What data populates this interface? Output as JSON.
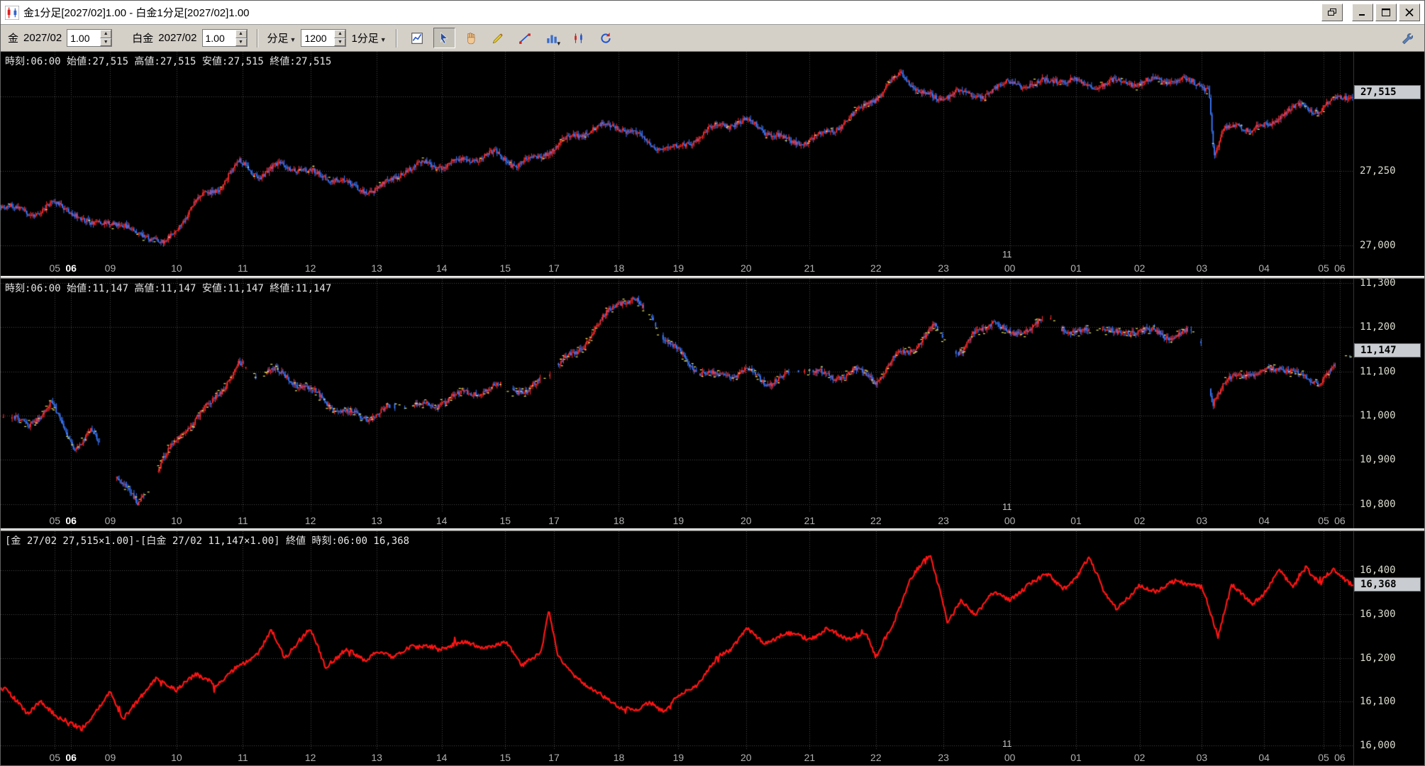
{
  "window": {
    "title": "金1分足[2027/02]1.00 - 白金1分足[2027/02]1.00"
  },
  "toolbar": {
    "gold_label": "金",
    "gold_contract": "2027/02",
    "gold_multiplier": "1.00",
    "platinum_label": "白金",
    "platinum_contract": "2027/02",
    "platinum_multiplier": "1.00",
    "interval_label": "分足",
    "bar_count": "1200",
    "timeframe": "1分足",
    "tools": [
      "chart-grid-tool",
      "pointer-tool",
      "hand-tool",
      "pencil-tool",
      "trendline-tool",
      "bar-chart-tool",
      "candle-chart-tool",
      "refresh-tool",
      "wrench-settings"
    ]
  },
  "x_axis": {
    "labels": [
      "05",
      "06",
      "09",
      "10",
      "11",
      "12",
      "13",
      "14",
      "15",
      "17",
      "18",
      "19",
      "20",
      "21",
      "22",
      "23",
      "00",
      "01",
      "02",
      "03",
      "04",
      "05",
      "06"
    ],
    "fractions": [
      0.04,
      0.052,
      0.081,
      0.13,
      0.179,
      0.229,
      0.278,
      0.326,
      0.373,
      0.409,
      0.457,
      0.501,
      0.551,
      0.598,
      0.647,
      0.697,
      0.746,
      0.795,
      0.842,
      0.888,
      0.934,
      0.978,
      0.99
    ],
    "bold_index": 1,
    "date_marker": {
      "label": "11",
      "fraction": 0.744
    }
  },
  "chart_data": [
    {
      "type": "candlestick",
      "symbol": "金",
      "contract": "2027/02",
      "timeframe": "1分足",
      "info_line": "時刻:06:00 始値:27,515 高値:27,515 安値:27,515 終値:27,515",
      "time": "06:00",
      "open": 27515,
      "high": 27515,
      "low": 27515,
      "close": 27515,
      "current_price": 27515,
      "current_price_label": "27,515",
      "ylim": [
        26950,
        27650
      ],
      "grid_values": [
        27500,
        27250,
        27000
      ],
      "y_ticks": [
        {
          "label": "27,250",
          "value": 27250
        },
        {
          "label": "27,000",
          "value": 27000
        }
      ],
      "bars": 1100,
      "volatility": 13,
      "seed": 11,
      "sparse": false,
      "yellow_prob": 0.06,
      "up_color": "#ff2d2d",
      "down_color": "#3b78ff",
      "accent_color": "#e8e85a",
      "waypoints": [
        [
          0.005,
          27130
        ],
        [
          0.02,
          27095
        ],
        [
          0.037,
          27140
        ],
        [
          0.054,
          27120
        ],
        [
          0.067,
          27070
        ],
        [
          0.081,
          27090
        ],
        [
          0.094,
          27050
        ],
        [
          0.108,
          27030
        ],
        [
          0.121,
          26995
        ],
        [
          0.131,
          27060
        ],
        [
          0.144,
          27150
        ],
        [
          0.161,
          27200
        ],
        [
          0.176,
          27285
        ],
        [
          0.192,
          27235
        ],
        [
          0.208,
          27270
        ],
        [
          0.225,
          27240
        ],
        [
          0.242,
          27230
        ],
        [
          0.262,
          27200
        ],
        [
          0.278,
          27190
        ],
        [
          0.296,
          27250
        ],
        [
          0.313,
          27270
        ],
        [
          0.329,
          27260
        ],
        [
          0.349,
          27290
        ],
        [
          0.366,
          27310
        ],
        [
          0.38,
          27280
        ],
        [
          0.397,
          27300
        ],
        [
          0.409,
          27330
        ],
        [
          0.423,
          27360
        ],
        [
          0.44,
          27390
        ],
        [
          0.457,
          27400
        ],
        [
          0.47,
          27370
        ],
        [
          0.484,
          27340
        ],
        [
          0.501,
          27330
        ],
        [
          0.517,
          27370
        ],
        [
          0.534,
          27400
        ],
        [
          0.551,
          27410
        ],
        [
          0.568,
          27380
        ],
        [
          0.585,
          27350
        ],
        [
          0.598,
          27360
        ],
        [
          0.615,
          27390
        ],
        [
          0.632,
          27440
        ],
        [
          0.649,
          27500
        ],
        [
          0.665,
          27570
        ],
        [
          0.679,
          27520
        ],
        [
          0.692,
          27490
        ],
        [
          0.706,
          27530
        ],
        [
          0.719,
          27500
        ],
        [
          0.733,
          27520
        ],
        [
          0.746,
          27540
        ],
        [
          0.763,
          27530
        ],
        [
          0.78,
          27560
        ],
        [
          0.796,
          27550
        ],
        [
          0.813,
          27545
        ],
        [
          0.83,
          27555
        ],
        [
          0.842,
          27540
        ],
        [
          0.86,
          27550
        ],
        [
          0.877,
          27545
        ],
        [
          0.888,
          27540
        ],
        [
          0.893,
          27530
        ],
        [
          0.897,
          27295
        ],
        [
          0.904,
          27390
        ],
        [
          0.914,
          27420
        ],
        [
          0.924,
          27390
        ],
        [
          0.934,
          27400
        ],
        [
          0.948,
          27440
        ],
        [
          0.961,
          27460
        ],
        [
          0.975,
          27450
        ],
        [
          0.985,
          27480
        ],
        [
          1.0,
          27515
        ]
      ]
    },
    {
      "type": "candlestick",
      "symbol": "白金",
      "contract": "2027/02",
      "timeframe": "1分足",
      "info_line": "時刻:06:00 始値:11,147 高値:11,147 安値:11,147 終値:11,147",
      "time": "06:00",
      "open": 11147,
      "high": 11147,
      "low": 11147,
      "close": 11147,
      "current_price": 11147,
      "current_price_label": "11,147",
      "ylim": [
        10780,
        11310
      ],
      "grid_values": [
        11300,
        11200,
        11100,
        11000,
        10900,
        10800
      ],
      "y_ticks": [
        {
          "label": "11,300",
          "value": 11300
        },
        {
          "label": "11,200",
          "value": 11200
        },
        {
          "label": "11,100",
          "value": 11100
        },
        {
          "label": "11,000",
          "value": 11000
        },
        {
          "label": "10,900",
          "value": 10900
        },
        {
          "label": "10,800",
          "value": 10800
        }
      ],
      "bars": 1100,
      "volatility": 9,
      "seed": 23,
      "sparse": true,
      "yellow_prob": 0.25,
      "up_color": "#ff2d2d",
      "down_color": "#3b78ff",
      "accent_color": "#e8e85a",
      "waypoints": [
        [
          0.005,
          11000
        ],
        [
          0.02,
          10970
        ],
        [
          0.037,
          11030
        ],
        [
          0.054,
          10930
        ],
        [
          0.067,
          10970
        ],
        [
          0.081,
          10890
        ],
        [
          0.094,
          10827
        ],
        [
          0.101,
          10795
        ],
        [
          0.115,
          10868
        ],
        [
          0.131,
          10950
        ],
        [
          0.15,
          11010
        ],
        [
          0.165,
          11073
        ],
        [
          0.176,
          11118
        ],
        [
          0.19,
          11093
        ],
        [
          0.2,
          11103
        ],
        [
          0.215,
          11077
        ],
        [
          0.229,
          11052
        ],
        [
          0.25,
          11010
        ],
        [
          0.27,
          11000
        ],
        [
          0.278,
          11010
        ],
        [
          0.3,
          11030
        ],
        [
          0.32,
          11014
        ],
        [
          0.326,
          11030
        ],
        [
          0.35,
          11052
        ],
        [
          0.373,
          11073
        ],
        [
          0.39,
          11056
        ],
        [
          0.409,
          11114
        ],
        [
          0.425,
          11134
        ],
        [
          0.44,
          11196
        ],
        [
          0.457,
          11257
        ],
        [
          0.468,
          11268
        ],
        [
          0.48,
          11227
        ],
        [
          0.49,
          11186
        ],
        [
          0.501,
          11145
        ],
        [
          0.515,
          11104
        ],
        [
          0.53,
          11083
        ],
        [
          0.551,
          11098
        ],
        [
          0.565,
          11073
        ],
        [
          0.58,
          11093
        ],
        [
          0.598,
          11114
        ],
        [
          0.615,
          11083
        ],
        [
          0.63,
          11104
        ],
        [
          0.647,
          11073
        ],
        [
          0.66,
          11124
        ],
        [
          0.675,
          11155
        ],
        [
          0.69,
          11206
        ],
        [
          0.697,
          11175
        ],
        [
          0.71,
          11145
        ],
        [
          0.72,
          11186
        ],
        [
          0.733,
          11216
        ],
        [
          0.746,
          11175
        ],
        [
          0.76,
          11196
        ],
        [
          0.775,
          11216
        ],
        [
          0.795,
          11186
        ],
        [
          0.81,
          11206
        ],
        [
          0.825,
          11186
        ],
        [
          0.842,
          11196
        ],
        [
          0.86,
          11175
        ],
        [
          0.877,
          11186
        ],
        [
          0.888,
          11165
        ],
        [
          0.896,
          11032
        ],
        [
          0.905,
          11073
        ],
        [
          0.915,
          11104
        ],
        [
          0.93,
          11093
        ],
        [
          0.945,
          11114
        ],
        [
          0.96,
          11083
        ],
        [
          0.975,
          11073
        ],
        [
          0.985,
          11104
        ],
        [
          1.0,
          11147
        ]
      ]
    },
    {
      "type": "line",
      "info_line": "[金 27/02 27,515×1.00]-[白金 27/02 11,147×1.00] 終値 時刻:06:00 16,368",
      "time": "06:00",
      "current_price": 16368,
      "current_price_label": "16,368",
      "ylim": [
        15990,
        16490
      ],
      "grid_values": [
        16400,
        16300,
        16200,
        16100,
        16000
      ],
      "y_ticks": [
        {
          "label": "16,400",
          "value": 16400
        },
        {
          "label": "16,300",
          "value": 16300
        },
        {
          "label": "16,200",
          "value": 16200
        },
        {
          "label": "16,100",
          "value": 16100
        },
        {
          "label": "16,000",
          "value": 16000
        }
      ],
      "seed": 5,
      "noise": 5,
      "line_color": "#ff1414",
      "waypoints": [
        [
          0.005,
          16130
        ],
        [
          0.02,
          16070
        ],
        [
          0.03,
          16100
        ],
        [
          0.045,
          16060
        ],
        [
          0.06,
          16035
        ],
        [
          0.07,
          16080
        ],
        [
          0.081,
          16120
        ],
        [
          0.09,
          16060
        ],
        [
          0.1,
          16100
        ],
        [
          0.115,
          16150
        ],
        [
          0.13,
          16130
        ],
        [
          0.145,
          16160
        ],
        [
          0.16,
          16140
        ],
        [
          0.176,
          16180
        ],
        [
          0.19,
          16210
        ],
        [
          0.2,
          16263
        ],
        [
          0.21,
          16200
        ],
        [
          0.22,
          16240
        ],
        [
          0.229,
          16265
        ],
        [
          0.24,
          16180
        ],
        [
          0.255,
          16220
        ],
        [
          0.27,
          16190
        ],
        [
          0.278,
          16220
        ],
        [
          0.29,
          16200
        ],
        [
          0.305,
          16230
        ],
        [
          0.326,
          16220
        ],
        [
          0.34,
          16240
        ],
        [
          0.355,
          16220
        ],
        [
          0.373,
          16240
        ],
        [
          0.385,
          16180
        ],
        [
          0.4,
          16220
        ],
        [
          0.405,
          16310
        ],
        [
          0.412,
          16200
        ],
        [
          0.425,
          16160
        ],
        [
          0.44,
          16120
        ],
        [
          0.457,
          16090
        ],
        [
          0.47,
          16075
        ],
        [
          0.48,
          16100
        ],
        [
          0.49,
          16080
        ],
        [
          0.501,
          16110
        ],
        [
          0.515,
          16140
        ],
        [
          0.53,
          16200
        ],
        [
          0.54,
          16220
        ],
        [
          0.551,
          16270
        ],
        [
          0.565,
          16230
        ],
        [
          0.58,
          16260
        ],
        [
          0.598,
          16240
        ],
        [
          0.61,
          16270
        ],
        [
          0.625,
          16240
        ],
        [
          0.64,
          16260
        ],
        [
          0.647,
          16200
        ],
        [
          0.66,
          16280
        ],
        [
          0.672,
          16380
        ],
        [
          0.687,
          16435
        ],
        [
          0.695,
          16350
        ],
        [
          0.7,
          16280
        ],
        [
          0.71,
          16330
        ],
        [
          0.72,
          16300
        ],
        [
          0.733,
          16350
        ],
        [
          0.746,
          16330
        ],
        [
          0.76,
          16370
        ],
        [
          0.775,
          16390
        ],
        [
          0.785,
          16360
        ],
        [
          0.795,
          16380
        ],
        [
          0.805,
          16430
        ],
        [
          0.815,
          16360
        ],
        [
          0.825,
          16310
        ],
        [
          0.835,
          16340
        ],
        [
          0.842,
          16370
        ],
        [
          0.855,
          16350
        ],
        [
          0.87,
          16380
        ],
        [
          0.888,
          16360
        ],
        [
          0.9,
          16250
        ],
        [
          0.91,
          16370
        ],
        [
          0.925,
          16320
        ],
        [
          0.934,
          16350
        ],
        [
          0.945,
          16400
        ],
        [
          0.955,
          16360
        ],
        [
          0.965,
          16410
        ],
        [
          0.975,
          16370
        ],
        [
          0.985,
          16400
        ],
        [
          1.0,
          16368
        ]
      ]
    }
  ],
  "colors": {
    "chart_bg": "#000000",
    "grid": "#484848",
    "chrome": "#d4d0c8",
    "badge_bg": "#c9cdd1",
    "up": "#ff2d2d",
    "down": "#3b78ff",
    "spread_line": "#ff1414"
  }
}
